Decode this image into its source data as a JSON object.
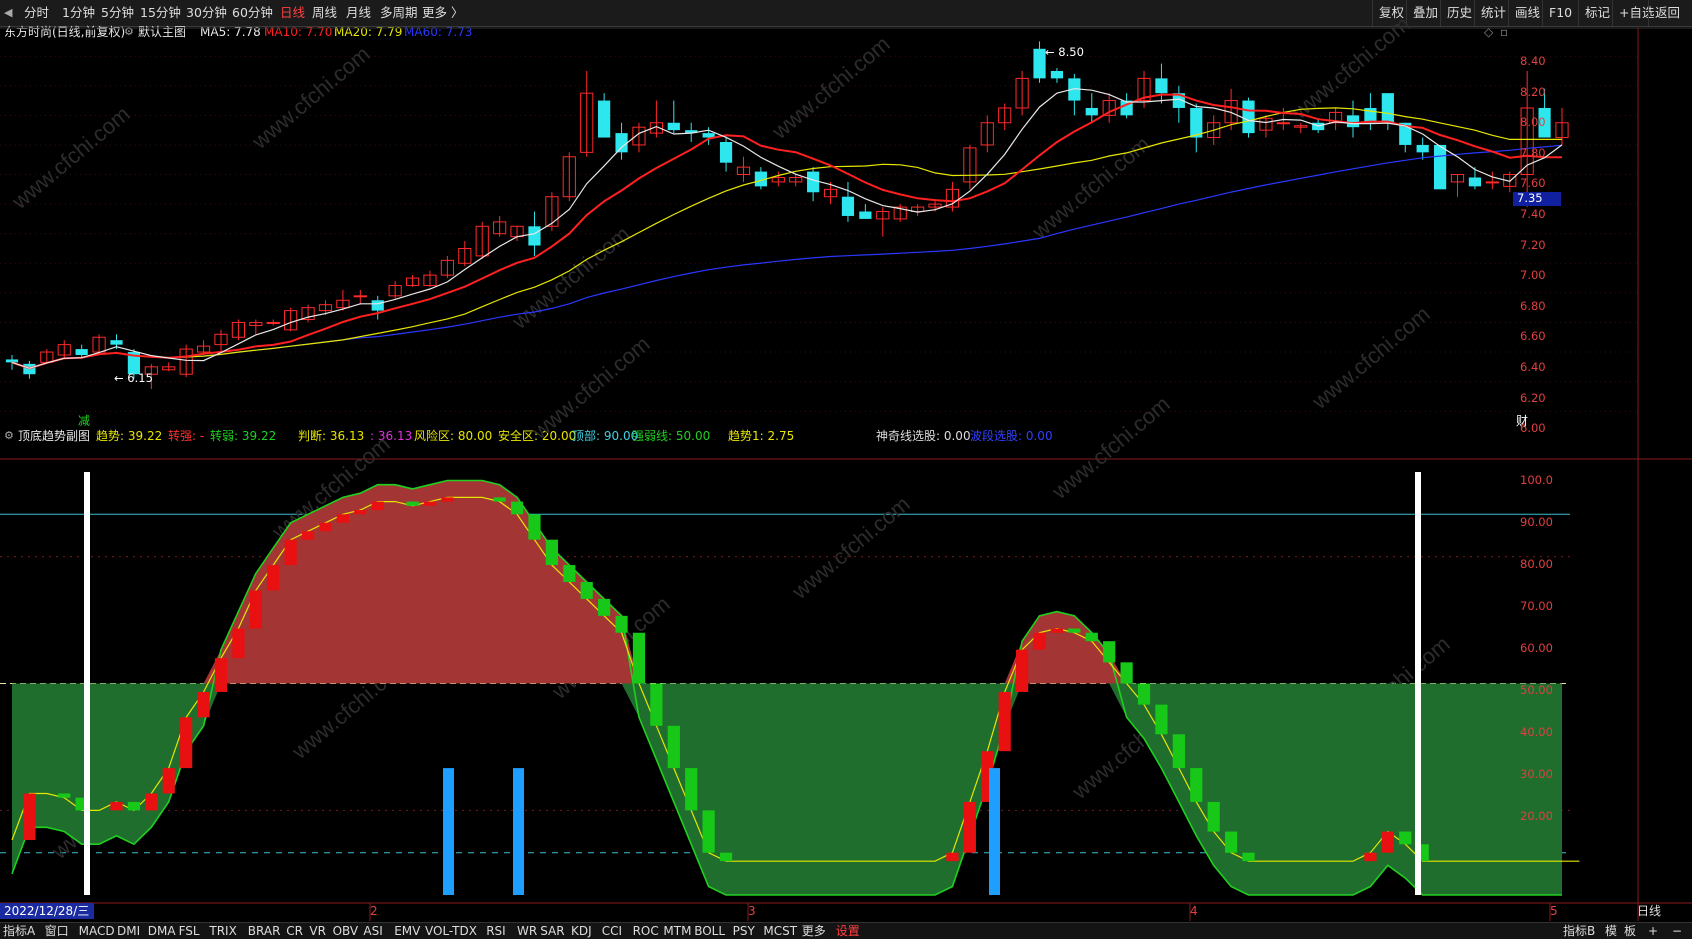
{
  "toolbar": {
    "periods": [
      {
        "label": "分时",
        "active": false
      },
      {
        "label": "1分钟",
        "active": false
      },
      {
        "label": "5分钟",
        "active": false
      },
      {
        "label": "15分钟",
        "active": false
      },
      {
        "label": "30分钟",
        "active": false
      },
      {
        "label": "60分钟",
        "active": false
      },
      {
        "label": "日线",
        "active": true
      },
      {
        "label": "周线",
        "active": false
      },
      {
        "label": "月线",
        "active": false
      },
      {
        "label": "多周期",
        "active": false
      },
      {
        "label": "更多 〉",
        "active": false
      }
    ],
    "right_buttons": [
      "复权",
      "叠加",
      "历史",
      "统计",
      "画线",
      "F10",
      "标记",
      "+自选",
      "返回"
    ]
  },
  "main_chart": {
    "title": "东方时尚(日线,前复权)",
    "indicator_name": "默认主图",
    "ma": [
      {
        "label": "MA5: 7.78",
        "color": "#e8e8e8"
      },
      {
        "label": "MA10: 7.70",
        "color": "#ff2020"
      },
      {
        "label": "MA20: 7.79",
        "color": "#e6e600"
      },
      {
        "label": "MA60: 7.73",
        "color": "#2a38ff"
      }
    ],
    "high_label": "8.50",
    "low_label": "6.15",
    "last_price": "7.35",
    "y_ticks": [
      "8.40",
      "8.20",
      "8.00",
      "7.80",
      "7.60",
      "7.40",
      "7.20",
      "7.00",
      "6.80",
      "6.60",
      "6.40",
      "6.20",
      "6.00"
    ],
    "marker_left": "减",
    "marker_right": "财"
  },
  "sub_chart": {
    "title": "顶底趋势副图",
    "params": [
      {
        "label": "趋势: 39.22",
        "color": "#e6e600"
      },
      {
        "label": "转强: -",
        "color": "#ff3030"
      },
      {
        "label": "转弱: 39.22",
        "color": "#20d020"
      },
      {
        "label": "判断: 36.13",
        "color": "#e6e600"
      },
      {
        "label": ": 36.13",
        "color": "#e030e0"
      },
      {
        "label": "风险区: 80.00",
        "color": "#e6e600"
      },
      {
        "label": "安全区: 20.00",
        "color": "#e6e600"
      },
      {
        "label": "顶部: 90.00",
        "color": "#40d0e0"
      },
      {
        "label": "强弱线: 50.00",
        "color": "#20d020"
      },
      {
        "label": "趋势1: 2.75",
        "color": "#e6e600"
      },
      {
        "label": "神奇线选股: 0.00",
        "color": "#dddddd"
      },
      {
        "label": "波段选股: 0.00",
        "color": "#3040ff"
      }
    ],
    "y_ticks": [
      "100.0",
      "90.00",
      "80.00",
      "70.00",
      "60.00",
      "50.00",
      "40.00",
      "30.00",
      "20.00"
    ]
  },
  "x_axis": {
    "date_label": "2022/12/28/三",
    "month_ticks": [
      "2",
      "3",
      "4",
      "5"
    ],
    "period_label": "日线"
  },
  "bottom_tabs": {
    "left": [
      "指标A",
      "窗口",
      "MACD",
      "DMI",
      "DMA",
      "FSL",
      "TRIX",
      "BRAR",
      "CR",
      "VR",
      "OBV",
      "ASI",
      "EMV",
      "VOL-TDX",
      "RSI",
      "WR",
      "SAR",
      "KDJ",
      "CCI",
      "ROC",
      "MTM",
      "BOLL",
      "PSY",
      "MCST",
      "更多",
      "设置"
    ],
    "selected": "设置",
    "right": [
      "指标B",
      "模",
      "板",
      "+",
      "−"
    ]
  },
  "watermark": "www.cfchi.com",
  "colors": {
    "up": "#ff2a2a",
    "down": "#2ee6ee",
    "sub_up": "#e81010",
    "sub_down": "#18c818",
    "area_red": "#a33535",
    "area_green": "#1f6e2e"
  },
  "chart_data": [
    {
      "type": "candlestick",
      "title": "东方时尚(日线,前复权)",
      "y_range": [
        5.9,
        8.55
      ],
      "candles": [
        [
          6.35,
          6.38,
          6.28,
          6.33
        ],
        [
          6.32,
          6.34,
          6.22,
          6.25
        ],
        [
          6.33,
          6.42,
          6.32,
          6.4
        ],
        [
          6.38,
          6.48,
          6.35,
          6.45
        ],
        [
          6.42,
          6.45,
          6.36,
          6.38
        ],
        [
          6.4,
          6.52,
          6.39,
          6.5
        ],
        [
          6.48,
          6.52,
          6.42,
          6.45
        ],
        [
          6.4,
          6.42,
          6.22,
          6.25
        ],
        [
          6.25,
          6.32,
          6.15,
          6.3
        ],
        [
          6.28,
          6.33,
          6.27,
          6.3
        ],
        [
          6.25,
          6.45,
          6.23,
          6.42
        ],
        [
          6.4,
          6.48,
          6.38,
          6.44
        ],
        [
          6.45,
          6.55,
          6.4,
          6.52
        ],
        [
          6.5,
          6.62,
          6.48,
          6.6
        ],
        [
          6.58,
          6.62,
          6.52,
          6.6
        ],
        [
          6.6,
          6.62,
          6.58,
          6.6
        ],
        [
          6.55,
          6.7,
          6.54,
          6.68
        ],
        [
          6.62,
          6.72,
          6.6,
          6.7
        ],
        [
          6.68,
          6.75,
          6.65,
          6.72
        ],
        [
          6.7,
          6.82,
          6.68,
          6.75
        ],
        [
          6.78,
          6.82,
          6.72,
          6.78
        ],
        [
          6.75,
          6.78,
          6.62,
          6.68
        ],
        [
          6.78,
          6.88,
          6.76,
          6.85
        ],
        [
          6.85,
          6.92,
          6.84,
          6.9
        ],
        [
          6.85,
          6.95,
          6.84,
          6.92
        ],
        [
          6.92,
          7.05,
          6.9,
          7.02
        ],
        [
          7.0,
          7.15,
          6.98,
          7.1
        ],
        [
          7.05,
          7.28,
          7.03,
          7.25
        ],
        [
          7.2,
          7.32,
          7.18,
          7.28
        ],
        [
          7.18,
          7.25,
          7.15,
          7.25
        ],
        [
          7.25,
          7.35,
          7.05,
          7.12
        ],
        [
          7.25,
          7.48,
          7.22,
          7.45
        ],
        [
          7.45,
          7.75,
          7.42,
          7.72
        ],
        [
          7.75,
          8.3,
          7.72,
          8.15
        ],
        [
          8.1,
          8.15,
          7.88,
          7.85
        ],
        [
          7.88,
          7.95,
          7.7,
          7.75
        ],
        [
          7.8,
          7.95,
          7.75,
          7.92
        ],
        [
          7.88,
          8.1,
          7.85,
          7.95
        ],
        [
          7.95,
          8.1,
          7.88,
          7.9
        ],
        [
          7.9,
          7.95,
          7.82,
          7.88
        ],
        [
          7.88,
          7.92,
          7.8,
          7.85
        ],
        [
          7.82,
          7.85,
          7.62,
          7.68
        ],
        [
          7.6,
          7.72,
          7.55,
          7.65
        ],
        [
          7.62,
          7.65,
          7.5,
          7.52
        ],
        [
          7.55,
          7.62,
          7.52,
          7.58
        ],
        [
          7.55,
          7.6,
          7.52,
          7.58
        ],
        [
          7.62,
          7.65,
          7.42,
          7.48
        ],
        [
          7.45,
          7.55,
          7.4,
          7.5
        ],
        [
          7.45,
          7.55,
          7.28,
          7.32
        ],
        [
          7.35,
          7.4,
          7.3,
          7.3
        ],
        [
          7.3,
          7.38,
          7.18,
          7.35
        ],
        [
          7.3,
          7.4,
          7.28,
          7.38
        ],
        [
          7.35,
          7.4,
          7.32,
          7.38
        ],
        [
          7.38,
          7.42,
          7.35,
          7.4
        ],
        [
          7.38,
          7.55,
          7.35,
          7.5
        ],
        [
          7.55,
          7.8,
          7.5,
          7.78
        ],
        [
          7.8,
          8.0,
          7.75,
          7.95
        ],
        [
          7.95,
          8.08,
          7.9,
          8.05
        ],
        [
          8.05,
          8.3,
          8.0,
          8.25
        ],
        [
          8.45,
          8.5,
          8.22,
          8.25
        ],
        [
          8.3,
          8.32,
          8.22,
          8.25
        ],
        [
          8.25,
          8.28,
          8.0,
          8.1
        ],
        [
          8.05,
          8.15,
          7.95,
          8.0
        ],
        [
          8.0,
          8.15,
          7.95,
          8.1
        ],
        [
          8.1,
          8.15,
          7.98,
          8.0
        ],
        [
          8.1,
          8.3,
          8.05,
          8.25
        ],
        [
          8.25,
          8.35,
          8.08,
          8.15
        ],
        [
          8.15,
          8.2,
          7.95,
          8.05
        ],
        [
          8.05,
          8.08,
          7.75,
          7.85
        ],
        [
          7.85,
          8.0,
          7.8,
          7.95
        ],
        [
          7.95,
          8.18,
          7.9,
          8.1
        ],
        [
          8.1,
          8.12,
          7.85,
          7.88
        ],
        [
          7.9,
          8.0,
          7.85,
          7.98
        ],
        [
          7.95,
          8.05,
          7.9,
          7.95
        ],
        [
          7.92,
          7.95,
          7.88,
          7.93
        ],
        [
          7.95,
          7.98,
          7.88,
          7.9
        ],
        [
          7.95,
          8.05,
          7.9,
          8.02
        ],
        [
          8.0,
          8.1,
          7.85,
          7.92
        ],
        [
          8.05,
          8.15,
          7.9,
          7.95
        ],
        [
          8.15,
          8.15,
          7.9,
          7.95
        ],
        [
          7.95,
          7.95,
          7.75,
          7.8
        ],
        [
          7.8,
          7.85,
          7.7,
          7.75
        ],
        [
          7.8,
          7.8,
          7.5,
          7.5
        ],
        [
          7.55,
          7.6,
          7.45,
          7.6
        ],
        [
          7.58,
          7.65,
          7.5,
          7.52
        ],
        [
          7.55,
          7.62,
          7.5,
          7.55
        ],
        [
          7.52,
          7.62,
          7.48,
          7.6
        ],
        [
          7.6,
          8.3,
          7.38,
          8.05
        ],
        [
          8.05,
          8.18,
          7.85,
          7.85
        ],
        [
          7.85,
          8.05,
          7.8,
          7.95
        ]
      ]
    },
    {
      "type": "line",
      "title": "顶底趋势副图",
      "y_range": [
        0,
        100
      ],
      "series": [
        {
          "name": "趋势",
          "values": [
            13,
            24,
            24,
            23,
            20,
            20,
            22,
            20,
            24,
            30,
            42,
            48,
            56,
            63,
            72,
            78,
            84,
            86,
            88,
            90,
            91,
            93,
            93,
            92,
            93,
            94,
            94,
            94,
            93,
            90,
            84,
            78,
            74,
            70,
            66,
            62,
            50,
            40,
            30,
            20,
            10,
            8,
            8,
            8,
            8,
            8,
            8,
            8,
            8,
            8,
            8,
            8,
            8,
            8,
            10,
            22,
            34,
            48,
            58,
            62,
            63,
            62,
            60,
            55,
            50,
            45,
            38,
            30,
            22,
            15,
            10,
            8,
            8,
            8,
            8,
            8,
            8,
            8,
            10,
            15,
            12,
            8,
            8,
            8,
            8,
            8,
            8,
            8,
            8,
            8,
            8
          ]
        },
        {
          "name": "强弱线",
          "values": [
            50,
            50,
            50,
            50,
            50,
            50,
            50,
            50,
            50,
            50,
            50,
            50,
            50,
            50,
            50,
            50,
            50,
            50,
            50,
            50,
            50,
            50,
            50,
            50,
            50,
            50,
            50,
            50,
            50,
            50,
            50,
            50,
            50,
            50,
            50,
            50,
            50,
            50,
            50,
            50,
            50,
            50,
            50,
            50,
            50,
            50,
            50,
            50,
            50,
            50,
            50,
            50,
            50,
            50,
            50,
            50,
            50,
            50,
            50,
            50,
            50,
            50,
            50,
            50,
            50,
            50,
            50,
            50,
            50,
            50,
            50,
            50,
            50,
            50,
            50,
            50,
            50,
            50,
            50,
            50,
            50,
            50,
            50,
            50,
            50,
            50,
            50,
            50,
            50,
            50,
            50
          ]
        }
      ],
      "reference_lines": {
        "顶部": 90,
        "风险区": 80,
        "强弱线": 50,
        "安全区": 20
      }
    }
  ]
}
